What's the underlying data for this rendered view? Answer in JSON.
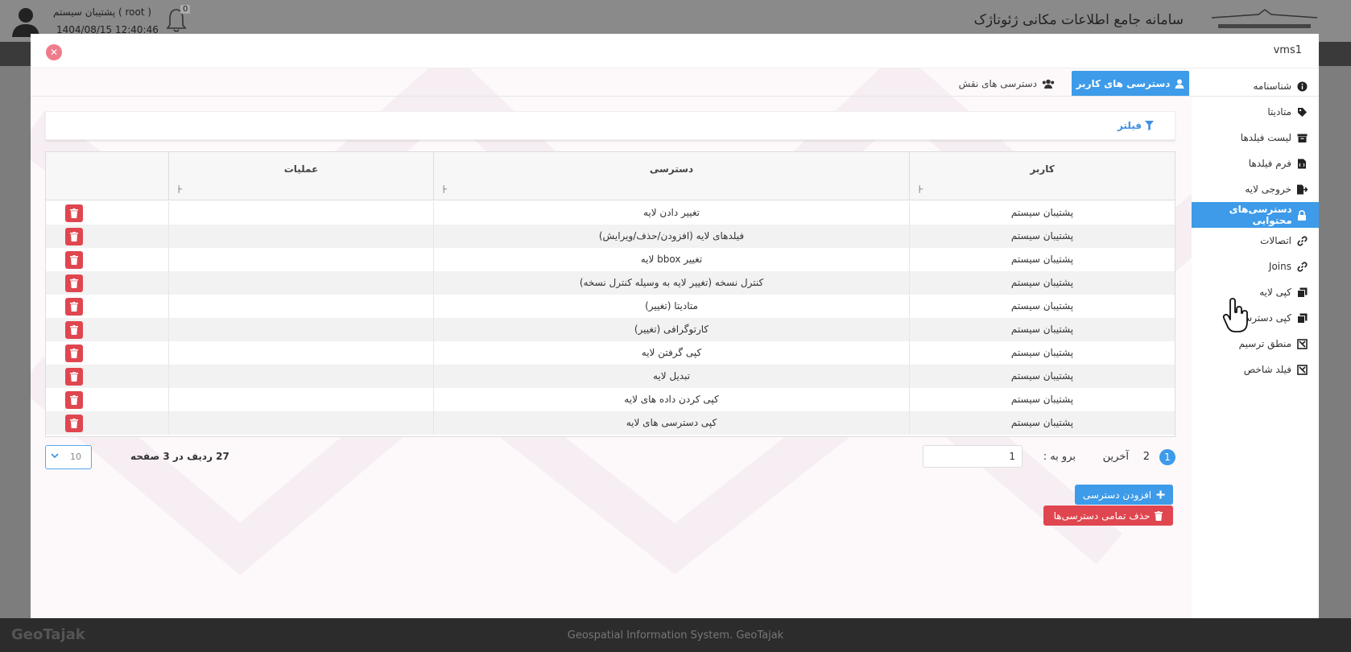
{
  "app": {
    "user_name": "پشتیبان سیستم ( root )",
    "datetime": "1404/08/15 12:40:46",
    "notification_count": "0",
    "system_title": "سامانه جامع اطلاعات مکانی ژئوتاژک",
    "footer_brand": "GeoTajak",
    "footer_caption": "Geospatial Information System. GeoTajak"
  },
  "modal": {
    "title": "vms1",
    "close_icon": "close-icon"
  },
  "side_menu": [
    {
      "label": "شناسنامه",
      "icon": "info-icon",
      "active": false
    },
    {
      "label": "متادیتا",
      "icon": "tag-icon",
      "active": false
    },
    {
      "label": "لیست فیلدها",
      "icon": "archive-icon",
      "active": false
    },
    {
      "label": "فرم فیلدها",
      "icon": "file-code-icon",
      "active": false
    },
    {
      "label": "خروجی لایه",
      "icon": "export-icon",
      "active": false
    },
    {
      "label": "دسترسی‌های محتوایی",
      "icon": "lock-icon",
      "active": true
    },
    {
      "label": "اتصالات",
      "icon": "link-icon",
      "active": false
    },
    {
      "label": "Joins",
      "icon": "link-icon",
      "active": false
    },
    {
      "label": "کپی لایه",
      "icon": "copy-icon",
      "active": false
    },
    {
      "label": "کپی دسترسی",
      "icon": "copy-icon",
      "active": false
    },
    {
      "label": "منطق ترسیم",
      "icon": "draw-logic-icon",
      "active": false
    },
    {
      "label": "فیلد شاخص",
      "icon": "draw-logic-icon",
      "active": false
    }
  ],
  "tabs": {
    "user_access": "دسترسی های کاربر",
    "role_access": "دسترسی های نقش"
  },
  "filter": {
    "label": "فیلتر"
  },
  "table": {
    "columns": [
      "کاربر",
      "دسترسی",
      "عملیات"
    ],
    "rows": [
      {
        "user": "پشتیبان سیستم",
        "access": "تغییر دادن لایه"
      },
      {
        "user": "پشتیبان سیستم",
        "access": "فیلدهای لایه (افزودن/حذف/ویرایش)"
      },
      {
        "user": "پشتیبان سیستم",
        "access": "تغییر bbox لایه"
      },
      {
        "user": "پشتیبان سیستم",
        "access": "کنترل نسخه (تغییر لایه به وسیله کنترل نسخه)"
      },
      {
        "user": "پشتیبان سیستم",
        "access": "متادیتا (تغییر)"
      },
      {
        "user": "پشتیبان سیستم",
        "access": "کارتوگرافی (تغییر)"
      },
      {
        "user": "پشتیبان سیستم",
        "access": "کپی گرفتن لایه"
      },
      {
        "user": "پشتیبان سیستم",
        "access": "تبدیل لایه"
      },
      {
        "user": "پشتیبان سیستم",
        "access": "کپی کردن داده های لایه"
      },
      {
        "user": "پشتیبان سیستم",
        "access": "کپی دسترسی های لایه"
      }
    ]
  },
  "pager": {
    "current_page": "1",
    "page_2": "2",
    "last_label": "آخرین",
    "goto_label": "برو به :",
    "goto_value": "1",
    "rows_info": "27 ردیف در 3 صفحه",
    "page_size": "10"
  },
  "actions": {
    "add_access": "افزودن دسترسی",
    "delete_all": "حذف تمامی دسترسی‌ها"
  },
  "colors": {
    "accent": "#3d9be9",
    "danger": "#e0464f",
    "close": "#f07b8b"
  }
}
